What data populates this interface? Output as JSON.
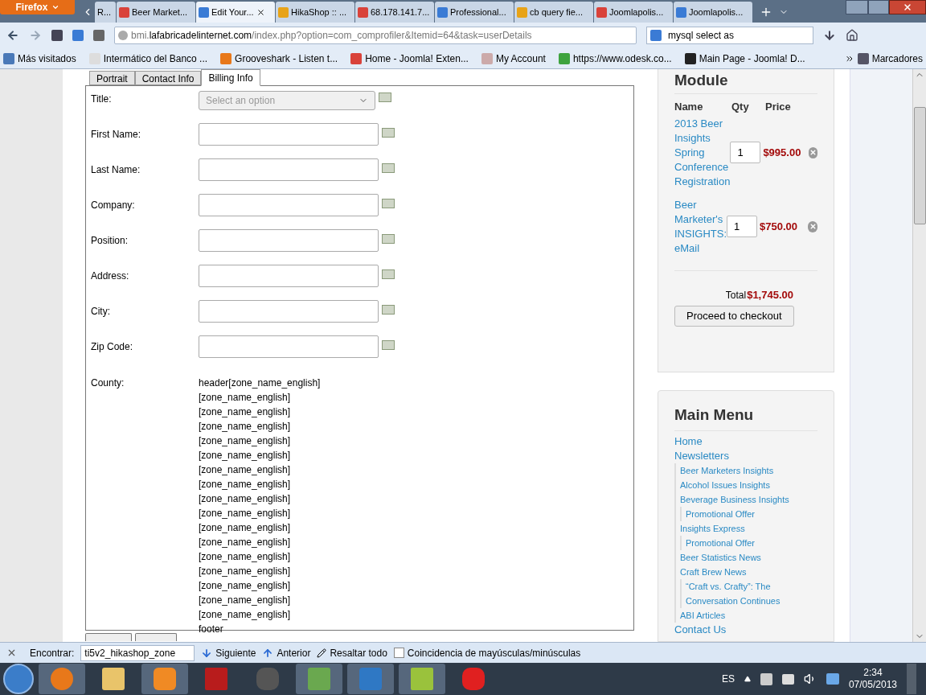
{
  "browser": {
    "menu_button": "Firefox",
    "tabs": [
      {
        "label": "R...",
        "selected": false
      },
      {
        "label": "Beer Market...",
        "selected": false
      },
      {
        "label": "Edit Your...",
        "selected": true
      },
      {
        "label": "HikaShop :: ...",
        "selected": false
      },
      {
        "label": "68.178.141.7...",
        "selected": false
      },
      {
        "label": "Professional...",
        "selected": false
      },
      {
        "label": "cb query fie...",
        "selected": false
      },
      {
        "label": "Joomlapolis...",
        "selected": false
      },
      {
        "label": "Joomlapolis...",
        "selected": false
      }
    ],
    "address": {
      "host_prefix": "bmi.",
      "host": "lafabricadelinternet.com",
      "path": "/index.php?option=com_comprofiler&Itemid=64&task=userDetails"
    },
    "search": "mysql select as",
    "bookmarks": [
      "Más visitados",
      "Intermático del Banco ...",
      "Grooveshark - Listen t...",
      "Home - Joomla! Exten...",
      "My Account",
      "https://www.odesk.co...",
      "Main Page - Joomla! D..."
    ],
    "bookmarks_menu": "Marcadores"
  },
  "form": {
    "tabs": [
      {
        "label": "Portrait",
        "selected": false
      },
      {
        "label": "Contact Info",
        "selected": false
      },
      {
        "label": "Billing Info",
        "selected": true
      }
    ],
    "fields": [
      {
        "label": "Title:",
        "kind": "select",
        "placeholder": "Select an option"
      },
      {
        "label": "First Name:",
        "kind": "text"
      },
      {
        "label": "Last Name:",
        "kind": "text"
      },
      {
        "label": "Company:",
        "kind": "text"
      },
      {
        "label": "Position:",
        "kind": "text"
      },
      {
        "label": "Address:",
        "kind": "text"
      },
      {
        "label": "City:",
        "kind": "text"
      },
      {
        "label": "Zip Code:",
        "kind": "text"
      }
    ],
    "county": {
      "label": "County:",
      "lines": [
        "header[zone_name_english]",
        "[zone_name_english]",
        "[zone_name_english]",
        "[zone_name_english]",
        "[zone_name_english]",
        "[zone_name_english]",
        "[zone_name_english]",
        "[zone_name_english]",
        "[zone_name_english]",
        "[zone_name_english]",
        "[zone_name_english]",
        "[zone_name_english]",
        "[zone_name_english]",
        "[zone_name_english]",
        "[zone_name_english]",
        "[zone_name_english]",
        "[zone_name_english]",
        "footer"
      ]
    }
  },
  "cart": {
    "title": "Module",
    "columns": [
      "Name",
      "Qty",
      "Price"
    ],
    "items": [
      {
        "name": "2013 Beer Insights Spring Conference Registration",
        "qty": "1",
        "price": "$995.00"
      },
      {
        "name": "Beer Marketer's INSIGHTS: eMail",
        "qty": "1",
        "price": "$750.00"
      }
    ],
    "total_label": "Total",
    "total": "$1,745.00",
    "checkout": "Proceed to checkout"
  },
  "menu": {
    "title": "Main Menu",
    "items": [
      {
        "label": "Home"
      },
      {
        "label": "Newsletters",
        "children": [
          {
            "label": "Beer Marketers Insights"
          },
          {
            "label": "Alcohol Issues Insights"
          },
          {
            "label": "Beverage Business Insights",
            "children": [
              {
                "label": "Promotional Offer"
              }
            ]
          },
          {
            "label": "Insights Express",
            "children": [
              {
                "label": "Promotional Offer"
              }
            ]
          },
          {
            "label": "Beer Statistics News"
          },
          {
            "label": "Craft Brew News",
            "children": [
              {
                "label": "“Craft vs. Crafty”: The Conversation Continues"
              }
            ]
          },
          {
            "label": "ABI Articles"
          }
        ]
      },
      {
        "label": "Contact Us"
      }
    ]
  },
  "find_bar": {
    "label": "Encontrar:",
    "value": "ti5v2_hikashop_zone",
    "next": "Siguiente",
    "previous": "Anterior",
    "highlight": "Resaltar todo",
    "match_case": {
      "label": "Coincidencia de mayúsculas/minúsculas",
      "checked": false
    }
  },
  "taskbar": {
    "language": "ES",
    "time": "2:34",
    "date": "07/05/2013"
  }
}
